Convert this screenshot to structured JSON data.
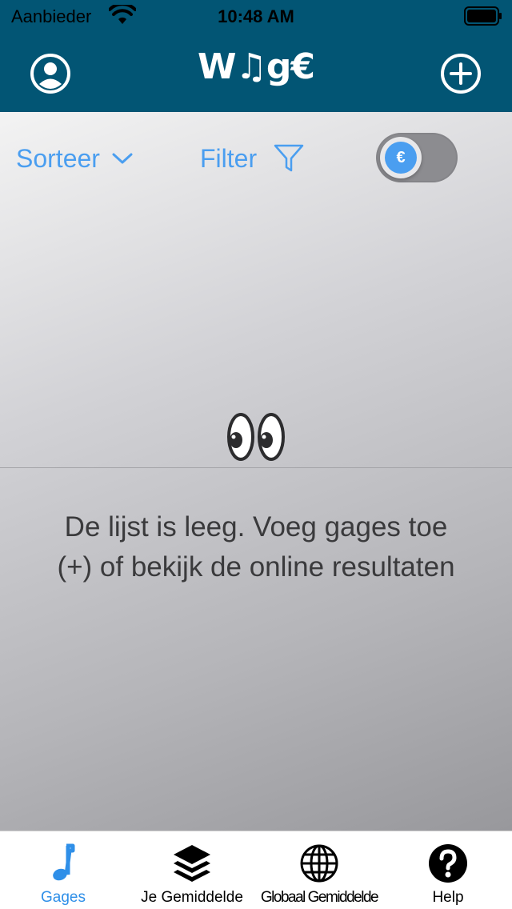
{
  "status_bar": {
    "carrier": "Aanbieder",
    "time": "10:48 AM"
  },
  "nav": {
    "logo_text": "W♫g€",
    "left_icon": "profile-icon",
    "right_icon": "add-circle-icon"
  },
  "toolbar": {
    "sort_label": "Sorteer",
    "filter_label": "Filter",
    "currency_toggle": {
      "symbol": "€",
      "on": false
    }
  },
  "empty_state": {
    "emoji": "👀",
    "message_line1": "De lijst is leeg. Voeg gages toe",
    "message_line2": "(+) of bekijk de online resultaten"
  },
  "tabbar": {
    "items": [
      {
        "label": "Gages",
        "icon": "music-note-icon",
        "active": true
      },
      {
        "label": "Je Gemiddelde",
        "icon": "layers-icon",
        "active": false
      },
      {
        "label": "Globaal Gemiddelde",
        "icon": "globe-icon",
        "active": false
      },
      {
        "label": "Help",
        "icon": "question-circle-icon",
        "active": false
      }
    ]
  },
  "colors": {
    "header_bg": "#025574",
    "accent": "#4a9ef0",
    "tab_active": "#2f8fe8"
  }
}
